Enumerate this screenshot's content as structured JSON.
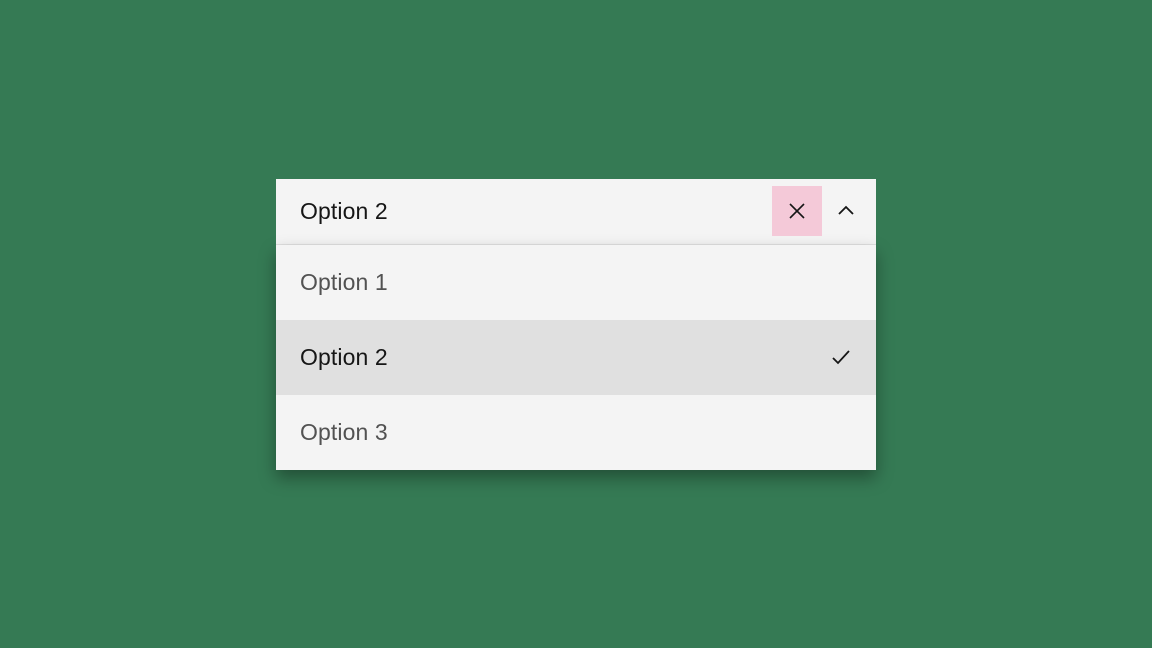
{
  "dropdown": {
    "selected_label": "Option 2",
    "options": [
      {
        "label": "Option 1",
        "selected": false
      },
      {
        "label": "Option 2",
        "selected": true
      },
      {
        "label": "Option 3",
        "selected": false
      }
    ]
  },
  "colors": {
    "background": "#357a54",
    "field_bg": "#f4f4f4",
    "selected_bg": "#e0e0e0",
    "clear_highlight": "#f4c9d8",
    "text_primary": "#161616",
    "text_secondary": "#525252"
  }
}
